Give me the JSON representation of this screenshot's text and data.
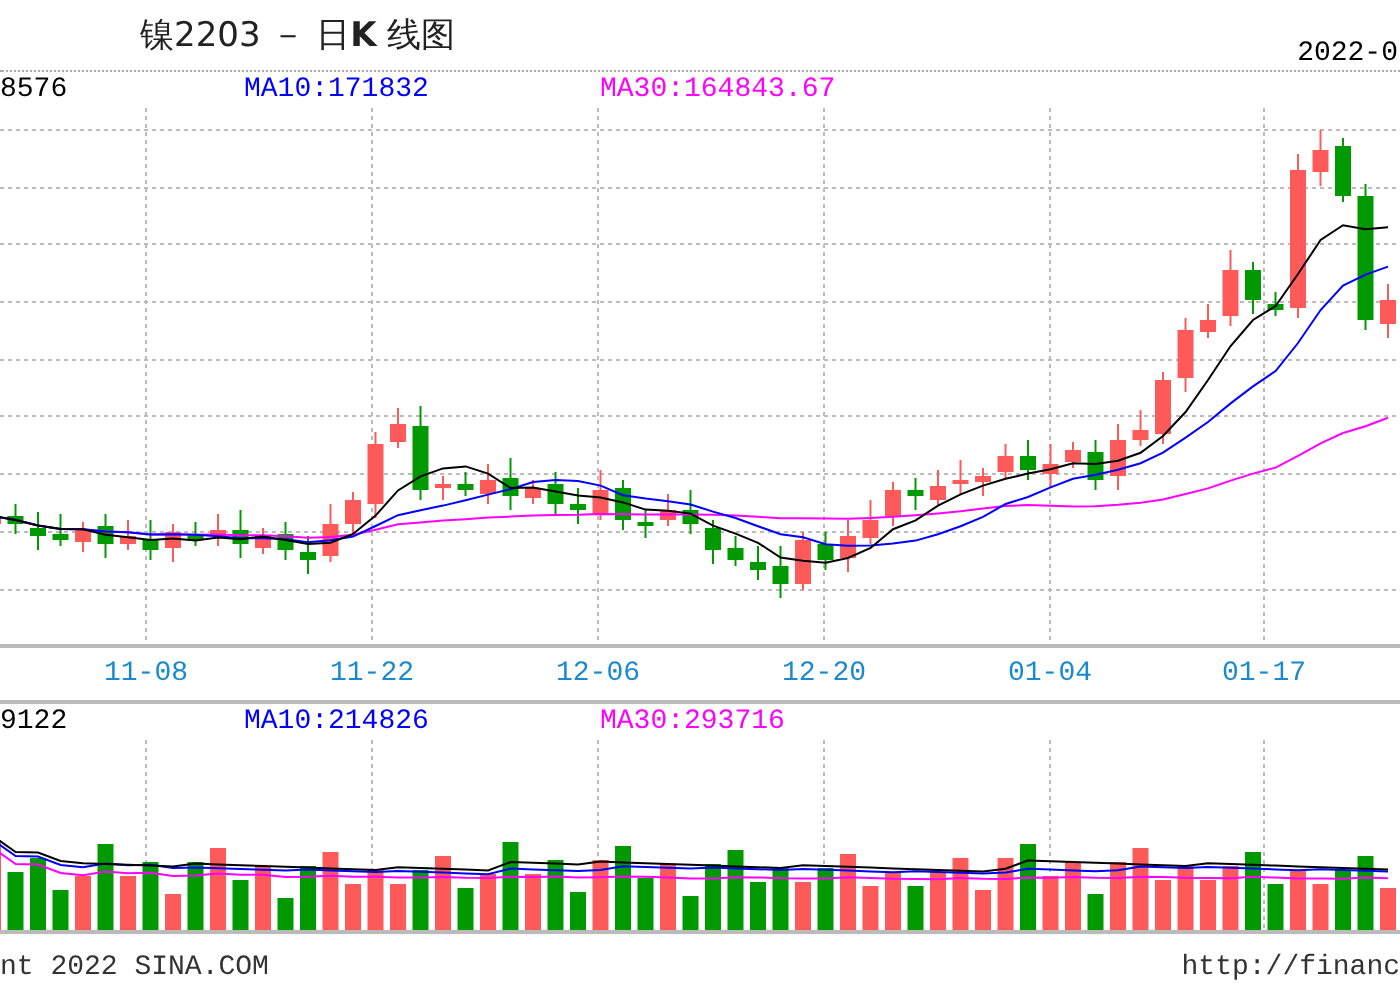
{
  "header": {
    "title": "镍2203 － 日**K** 线图",
    "date": "2022-0"
  },
  "price_panel": {
    "legend": [
      {
        "text": "8576",
        "color": "#000000"
      },
      {
        "text": "MA10:171832",
        "color": "#0000ff"
      },
      {
        "text": "MA30:164843.67",
        "color": "#ff00ff"
      }
    ]
  },
  "x_axis": {
    "labels": [
      "11-08",
      "11-22",
      "12-06",
      "12-20",
      "01-04",
      "01-17"
    ]
  },
  "volume_panel": {
    "legend": [
      {
        "text": "9122",
        "color": "#000000"
      },
      {
        "text": "MA10:214826",
        "color": "#0000ff"
      },
      {
        "text": "MA30:293716",
        "color": "#ff00ff"
      }
    ]
  },
  "footer": {
    "copyright": "nt 2022 SINA.COM",
    "url": "http://financ"
  }
}
